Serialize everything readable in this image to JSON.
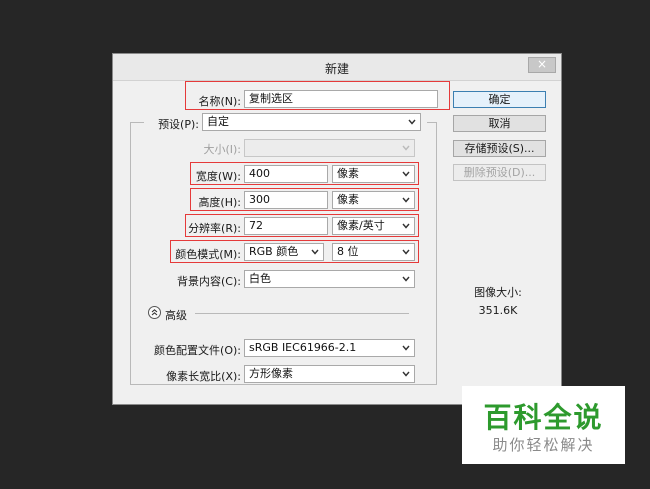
{
  "dialog": {
    "title": "新建",
    "close_label": "×"
  },
  "form": {
    "name_label": "名称(N):",
    "name_value": "复制选区",
    "preset_label": "预设(P):",
    "preset_value": "自定",
    "size_label": "大小(I):",
    "size_value": "",
    "width_label": "宽度(W):",
    "width_value": "400",
    "width_unit": "像素",
    "height_label": "高度(H):",
    "height_value": "300",
    "height_unit": "像素",
    "resolution_label": "分辨率(R):",
    "resolution_value": "72",
    "resolution_unit": "像素/英寸",
    "color_mode_label": "颜色模式(M):",
    "color_mode_value": "RGB 颜色",
    "bit_depth_value": "8 位",
    "background_label": "背景内容(C):",
    "background_value": "白色",
    "advanced_label": "高级",
    "color_profile_label": "颜色配置文件(O):",
    "color_profile_value": "sRGB IEC61966-2.1",
    "pixel_aspect_label": "像素长宽比(X):",
    "pixel_aspect_value": "方形像素"
  },
  "buttons": {
    "ok": "确定",
    "cancel": "取消",
    "save_preset": "存储预设(S)...",
    "delete_preset": "删除预设(D)..."
  },
  "info": {
    "image_size_label": "图像大小:",
    "image_size_value": "351.6K"
  },
  "watermark": {
    "main": "百科全说",
    "sub": "助你轻松解决"
  },
  "colors": {
    "highlight": "#e53a3a",
    "watermark_green": "#2d9a2d"
  }
}
